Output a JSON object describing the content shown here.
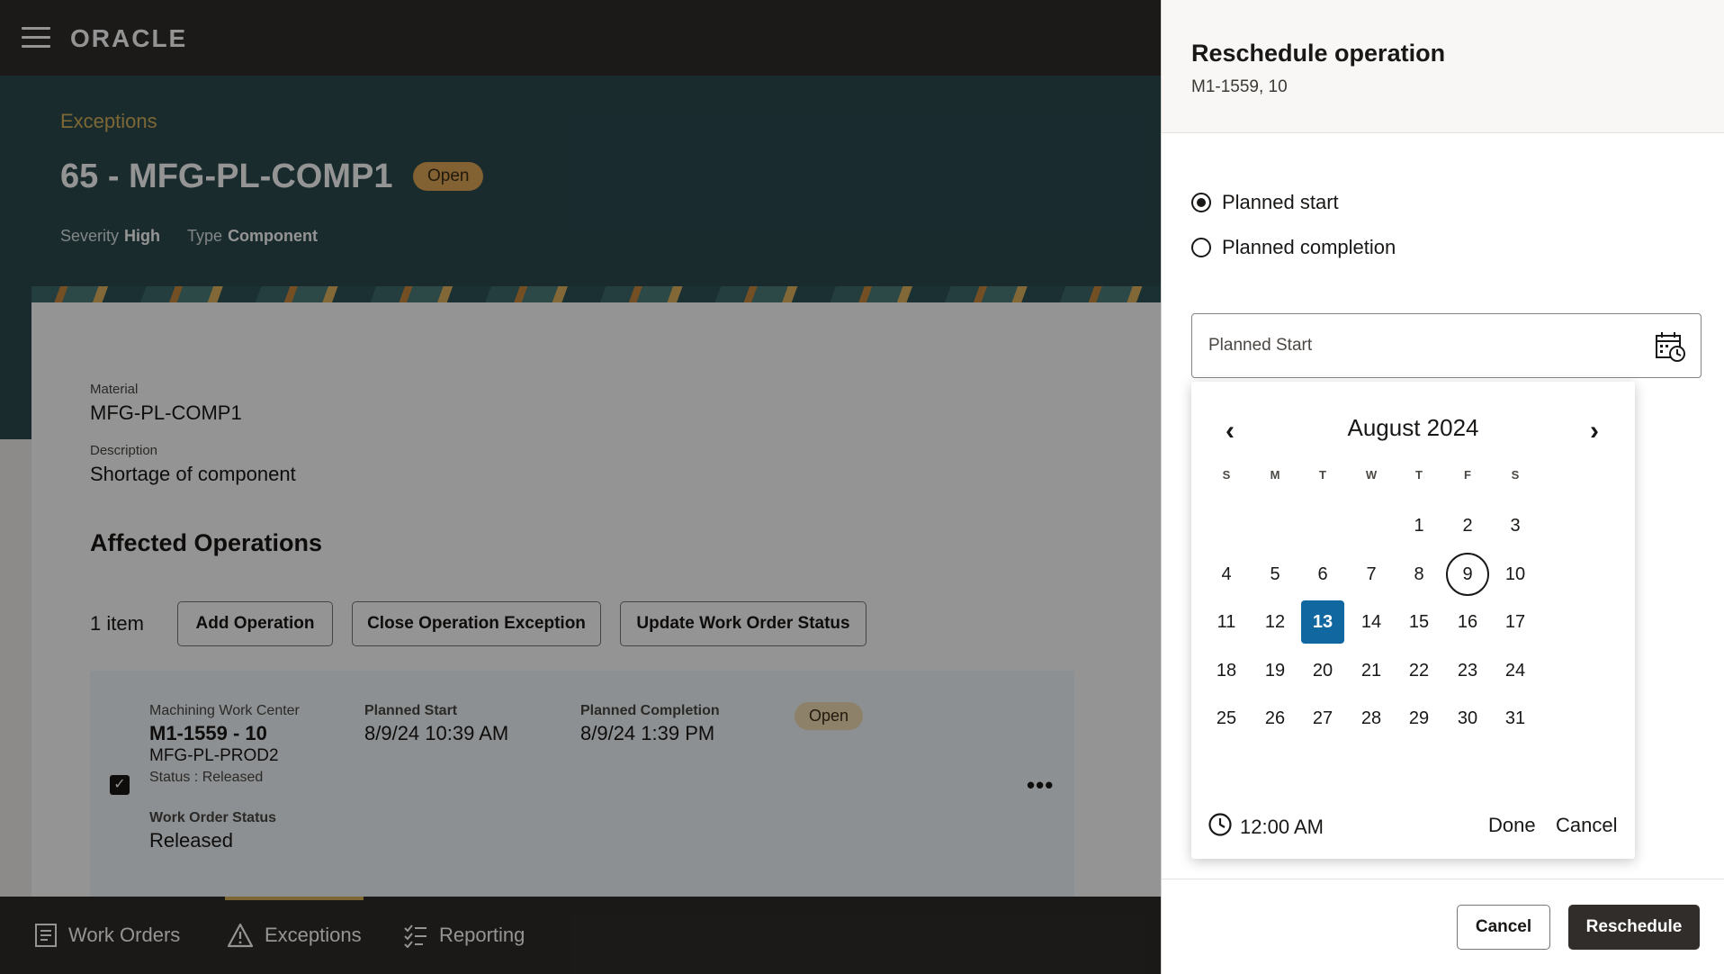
{
  "app": {
    "logo": "ORACLE",
    "breadcrumb": "Exceptions",
    "title": "65 - MFG-PL-COMP1",
    "title_badge": "Open",
    "severity_label": "Severity",
    "severity_value": "High",
    "type_label": "Type",
    "type_value": "Component"
  },
  "details": {
    "material_label": "Material",
    "material_value": "MFG-PL-COMP1",
    "description_label": "Description",
    "description_value": "Shortage of component"
  },
  "affected": {
    "title": "Affected Operations",
    "count": "1 item",
    "add_label": "Add Operation",
    "close_label": "Close Operation Exception",
    "update_label": "Update Work Order Status"
  },
  "operation": {
    "work_center": "Machining Work Center",
    "name": "M1-1559 - 10",
    "item": "MFG-PL-PROD2",
    "status": "Status : Released",
    "wo_status_label": "Work Order Status",
    "wo_status_value": "Released",
    "start_label": "Planned Start",
    "start_value": "8/9/24 10:39 AM",
    "completion_label": "Planned Completion",
    "completion_value": "8/9/24 1:39 PM",
    "badge": "Open",
    "more": "•••",
    "checked": "✓"
  },
  "bottom_nav": [
    {
      "label": "Work Orders",
      "icon": "document-icon"
    },
    {
      "label": "Exceptions",
      "icon": "warning-icon",
      "active": true
    },
    {
      "label": "Reporting",
      "icon": "checklist-icon"
    }
  ],
  "drawer": {
    "title": "Reschedule operation",
    "subtitle": "M1-1559, 10",
    "radio_start": "Planned start",
    "radio_completion": "Planned completion",
    "selected_radio": "Planned start",
    "date_placeholder": "Planned Start",
    "cancel_label": "Cancel",
    "reschedule_label": "Reschedule"
  },
  "datepicker": {
    "month_year": "August 2024",
    "prev": "‹",
    "next": "›",
    "days_of_week": [
      "S",
      "M",
      "T",
      "W",
      "T",
      "F",
      "S"
    ],
    "first_weekday": 4,
    "days_in_month": 31,
    "today": 9,
    "selected": 13,
    "time": "12:00 AM",
    "done_label": "Done",
    "cancel_label": "Cancel"
  },
  "colors": {
    "accent_selected": "#1167a0",
    "hero_teal": "#2b4a4f",
    "header_dark": "#312d2a",
    "badge_gold": "#e0a856"
  }
}
